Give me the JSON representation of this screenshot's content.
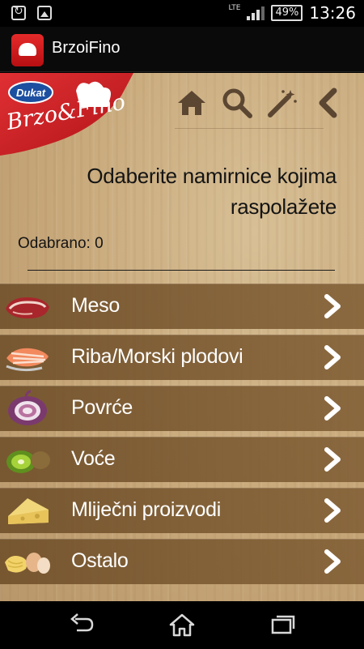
{
  "status_bar": {
    "network": "LTE",
    "battery": "49%",
    "time": "13:26"
  },
  "action_bar": {
    "title": "BrzoiFino"
  },
  "brand": {
    "logo_text_top": "Dukat",
    "logo_text_bottom": "Brzo&Fino",
    "accent_color": "#cf1f25"
  },
  "toolbar": {
    "icons": [
      "home-icon",
      "search-icon",
      "magic-wand-icon",
      "back-chevron-icon"
    ]
  },
  "main": {
    "heading_line1": "Odaberite namirnice kojima",
    "heading_line2": "raspolažete",
    "selected_label": "Odabrano: 0"
  },
  "categories": [
    {
      "label": "Meso",
      "icon": "meat-icon"
    },
    {
      "label": "Riba/Morski plodovi",
      "icon": "fish-icon"
    },
    {
      "label": "Povrće",
      "icon": "onion-icon"
    },
    {
      "label": "Voće",
      "icon": "kiwi-icon"
    },
    {
      "label": "Mliječni proizvodi",
      "icon": "cheese-icon"
    },
    {
      "label": "Ostalo",
      "icon": "pasta-eggs-icon"
    }
  ],
  "system_nav": {
    "icons": [
      "back-icon",
      "home-icon",
      "recent-apps-icon"
    ]
  }
}
